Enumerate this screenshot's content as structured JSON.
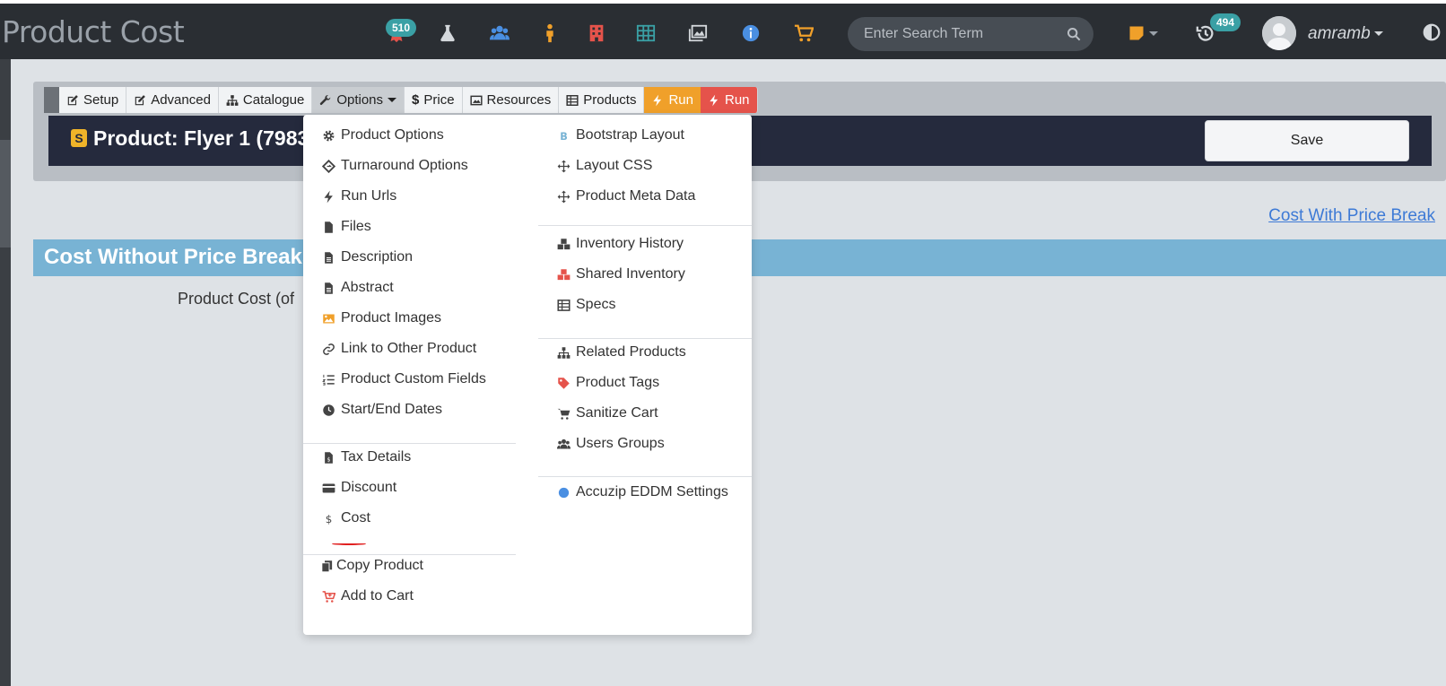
{
  "navbar": {
    "title": "Product Cost",
    "badges": {
      "awards": "510",
      "history": "494"
    },
    "search": {
      "placeholder": "Enter Search Term",
      "value": ""
    },
    "username": "amramb",
    "icons": [
      "award-icon",
      "flask-icon",
      "users-icon",
      "person-icon",
      "building-icon",
      "table-icon",
      "images-icon",
      "info-icon",
      "cart-icon",
      "sticky-note-icon",
      "history-icon",
      "contrast-icon"
    ],
    "colors": {
      "bg": "#2a2e33",
      "award": "#e5534b",
      "flask": "#d4d8dc",
      "users": "#4a8fe2",
      "person": "#f0a02a",
      "building": "#e5534b",
      "table": "#3aa0a5",
      "info": "#4a8fe2",
      "cart": "#f0a02a"
    }
  },
  "tabs": {
    "setup": "Setup",
    "advanced": "Advanced",
    "catalogue": "Catalogue",
    "options": "Options",
    "price": "Price",
    "resources": "Resources",
    "products": "Products",
    "run1": "Run",
    "run2": "Run"
  },
  "product": {
    "title": "Product: Flyer 1 (7983",
    "badge": "S",
    "save_label": "Save"
  },
  "links": {
    "cost_with_price_break": "Cost With Price Break"
  },
  "section": {
    "title": "Cost Without Price Breaks",
    "product_cost_label": "Product Cost (of"
  },
  "menu": {
    "left": [
      {
        "label": "Product Options",
        "icon": "gear-icon"
      },
      {
        "label": "Turnaround Options",
        "icon": "diamond-icon"
      },
      {
        "label": "Run Urls",
        "icon": "bolt-icon"
      },
      {
        "label": "Files",
        "icon": "file-icon"
      },
      {
        "label": "Description",
        "icon": "file-text-icon"
      },
      {
        "label": "Abstract",
        "icon": "file-text-icon"
      },
      {
        "label": "Product Images",
        "icon": "image-icon"
      },
      {
        "label": "Link to Other Product",
        "icon": "link-icon"
      },
      {
        "label": "Product Custom Fields",
        "icon": "list-ol-icon"
      },
      {
        "label": "Start/End Dates",
        "icon": "clock-icon"
      },
      {
        "label": "Tax Details",
        "icon": "file-invoice-icon"
      },
      {
        "label": "Discount",
        "icon": "credit-card-icon"
      },
      {
        "label": "Cost",
        "icon": "dollar-icon"
      },
      {
        "label": "Copy Product",
        "icon": "copy-icon"
      },
      {
        "label": "Add to Cart",
        "icon": "cart-plus-icon"
      }
    ],
    "right": [
      {
        "label": "Bootstrap Layout",
        "icon": "bootstrap-icon"
      },
      {
        "label": "Layout CSS",
        "icon": "arrows-icon"
      },
      {
        "label": "Product Meta Data",
        "icon": "arrows-icon"
      },
      {
        "label": "Inventory History",
        "icon": "cubes-icon"
      },
      {
        "label": "Shared Inventory",
        "icon": "cubes-icon"
      },
      {
        "label": "Specs",
        "icon": "table-icon"
      },
      {
        "label": "Related Products",
        "icon": "sitemap-icon"
      },
      {
        "label": "Product Tags",
        "icon": "tag-icon"
      },
      {
        "label": "Sanitize Cart",
        "icon": "cart-icon"
      },
      {
        "label": "Users Groups",
        "icon": "users-icon"
      },
      {
        "label": "Accuzip EDDM Settings",
        "icon": "circle-icon"
      }
    ]
  }
}
